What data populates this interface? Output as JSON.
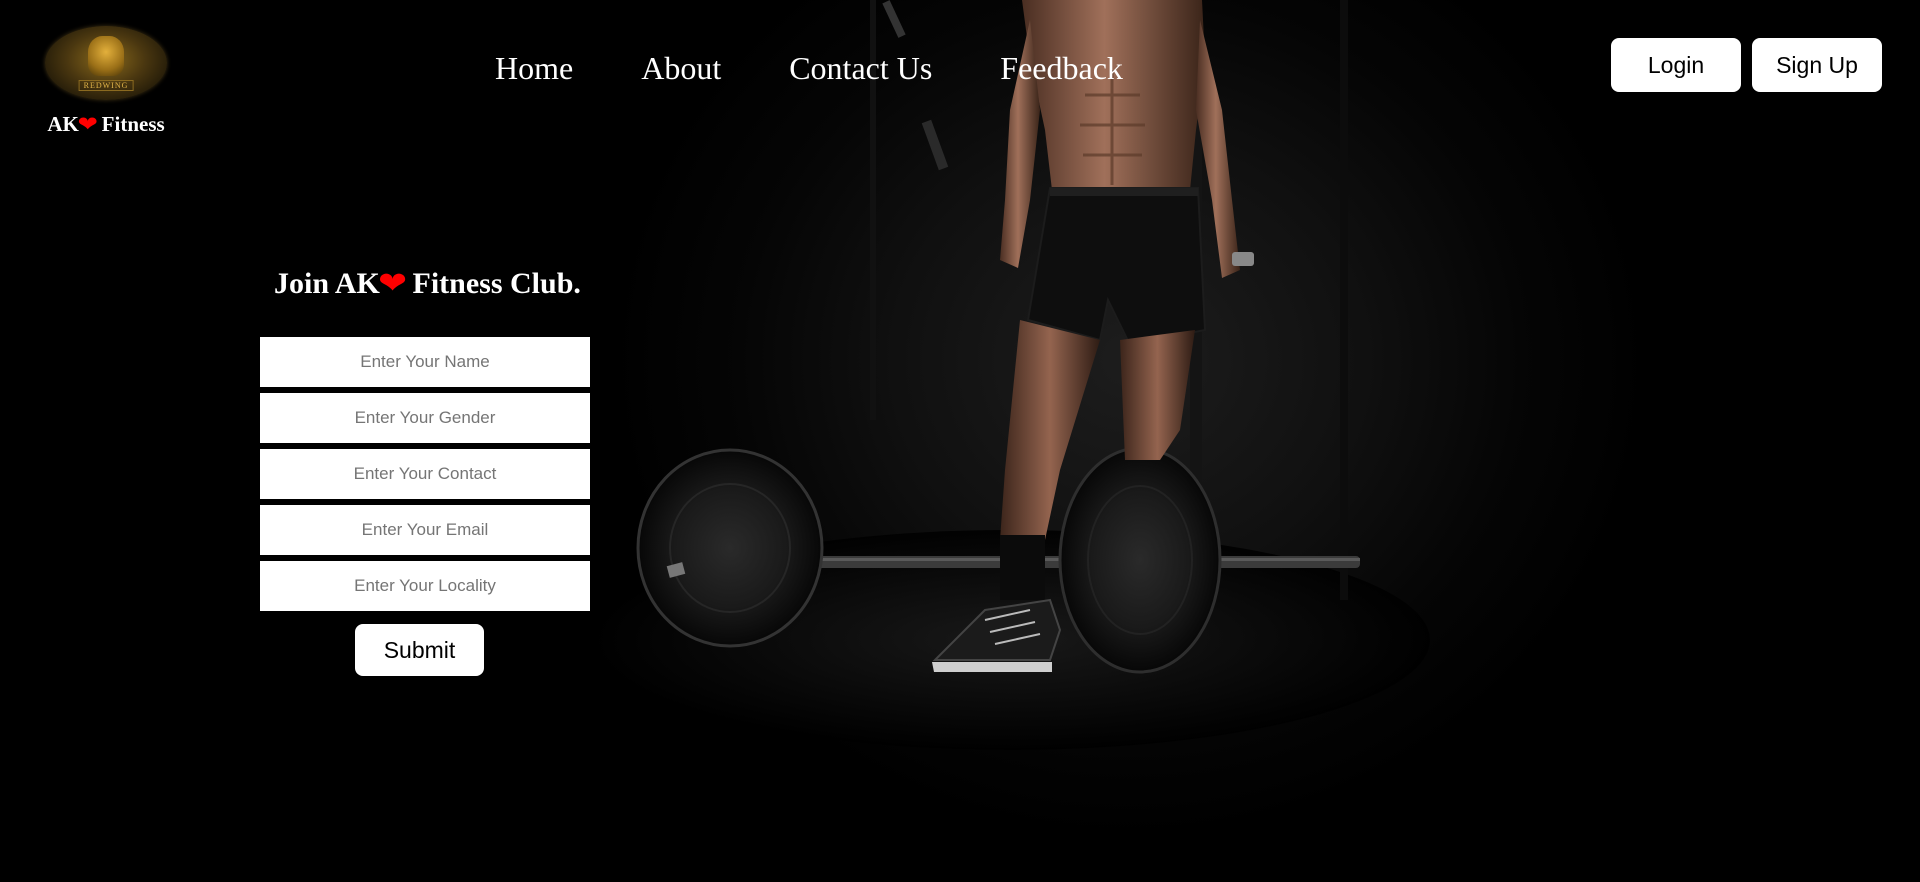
{
  "brand": {
    "logo_text": "REDWING",
    "name_prefix": "AK",
    "heart": "❤",
    "name_suffix": " Fitness"
  },
  "nav": {
    "items": [
      "Home",
      "About",
      "Contact Us",
      "Feedback"
    ]
  },
  "auth": {
    "login_label": "Login",
    "signup_label": "Sign Up"
  },
  "join": {
    "title_prefix": "Join AK",
    "title_heart": "❤",
    "title_suffix": " Fitness Club.",
    "fields": {
      "name_placeholder": "Enter Your Name",
      "gender_placeholder": "Enter Your Gender",
      "contact_placeholder": "Enter Your Contact",
      "email_placeholder": "Enter Your Email",
      "locality_placeholder": "Enter Your Locality"
    },
    "submit_label": "Submit"
  },
  "colors": {
    "background": "#000000",
    "heart": "#ff0000",
    "button_bg": "#ffffff",
    "text": "#ffffff"
  }
}
